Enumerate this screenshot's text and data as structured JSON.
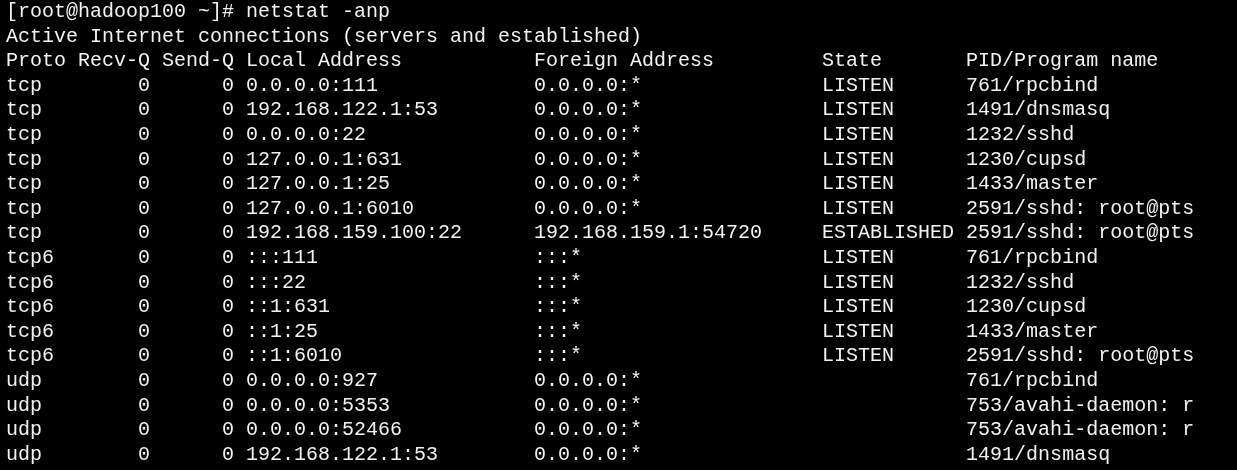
{
  "command_line": "[root@hadoop100 ~]# netstat -anp",
  "output_title": "Active Internet connections (servers and established)",
  "columns": [
    "Proto",
    "Recv-Q",
    "Send-Q",
    "Local Address",
    "Foreign Address",
    "State",
    "PID/Program name"
  ],
  "rows": [
    {
      "proto": "tcp",
      "recv_q": "0",
      "send_q": "0",
      "local": "0.0.0.0:111",
      "foreign": "0.0.0.0:*",
      "state": "LISTEN",
      "program": "761/rpcbind"
    },
    {
      "proto": "tcp",
      "recv_q": "0",
      "send_q": "0",
      "local": "192.168.122.1:53",
      "foreign": "0.0.0.0:*",
      "state": "LISTEN",
      "program": "1491/dnsmasq"
    },
    {
      "proto": "tcp",
      "recv_q": "0",
      "send_q": "0",
      "local": "0.0.0.0:22",
      "foreign": "0.0.0.0:*",
      "state": "LISTEN",
      "program": "1232/sshd"
    },
    {
      "proto": "tcp",
      "recv_q": "0",
      "send_q": "0",
      "local": "127.0.0.1:631",
      "foreign": "0.0.0.0:*",
      "state": "LISTEN",
      "program": "1230/cupsd"
    },
    {
      "proto": "tcp",
      "recv_q": "0",
      "send_q": "0",
      "local": "127.0.0.1:25",
      "foreign": "0.0.0.0:*",
      "state": "LISTEN",
      "program": "1433/master"
    },
    {
      "proto": "tcp",
      "recv_q": "0",
      "send_q": "0",
      "local": "127.0.0.1:6010",
      "foreign": "0.0.0.0:*",
      "state": "LISTEN",
      "program": "2591/sshd: root@pts"
    },
    {
      "proto": "tcp",
      "recv_q": "0",
      "send_q": "0",
      "local": "192.168.159.100:22",
      "foreign": "192.168.159.1:54720",
      "state": "ESTABLISHED",
      "program": "2591/sshd: root@pts"
    },
    {
      "proto": "tcp6",
      "recv_q": "0",
      "send_q": "0",
      "local": ":::111",
      "foreign": ":::*",
      "state": "LISTEN",
      "program": "761/rpcbind"
    },
    {
      "proto": "tcp6",
      "recv_q": "0",
      "send_q": "0",
      "local": ":::22",
      "foreign": ":::*",
      "state": "LISTEN",
      "program": "1232/sshd"
    },
    {
      "proto": "tcp6",
      "recv_q": "0",
      "send_q": "0",
      "local": "::1:631",
      "foreign": ":::*",
      "state": "LISTEN",
      "program": "1230/cupsd"
    },
    {
      "proto": "tcp6",
      "recv_q": "0",
      "send_q": "0",
      "local": "::1:25",
      "foreign": ":::*",
      "state": "LISTEN",
      "program": "1433/master"
    },
    {
      "proto": "tcp6",
      "recv_q": "0",
      "send_q": "0",
      "local": "::1:6010",
      "foreign": ":::*",
      "state": "LISTEN",
      "program": "2591/sshd: root@pts"
    },
    {
      "proto": "udp",
      "recv_q": "0",
      "send_q": "0",
      "local": "0.0.0.0:927",
      "foreign": "0.0.0.0:*",
      "program": "761/rpcbind"
    },
    {
      "proto": "udp",
      "recv_q": "0",
      "send_q": "0",
      "local": "0.0.0.0:5353",
      "foreign": "0.0.0.0:*",
      "program": "753/avahi-daemon: r"
    },
    {
      "proto": "udp",
      "recv_q": "0",
      "send_q": "0",
      "local": "0.0.0.0:52466",
      "foreign": "0.0.0.0:*",
      "program": "753/avahi-daemon: r"
    },
    {
      "proto": "udp",
      "recv_q": "0",
      "send_q": "0",
      "local": "192.168.122.1:53",
      "foreign": "0.0.0.0:*",
      "program": "1491/dnsmasq"
    }
  ]
}
